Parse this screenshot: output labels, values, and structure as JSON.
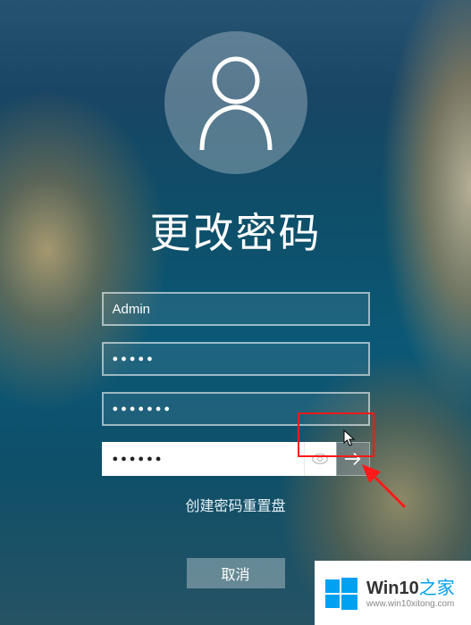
{
  "title": "更改密码",
  "username": {
    "value": "Admin"
  },
  "old_password": {
    "mask": "●●●●●"
  },
  "new_password": {
    "mask": "●●●●●●●"
  },
  "confirm_password": {
    "mask": "●●●●●●"
  },
  "link_reset": "创建密码重置盘",
  "cancel_label": "取消",
  "watermark": {
    "brand_prefix": "Win10",
    "brand_suffix": "之家",
    "url": "www.win10xitong.com"
  },
  "icons": {
    "user": "user-icon",
    "reveal": "eye-icon",
    "submit": "arrow-right-icon"
  }
}
